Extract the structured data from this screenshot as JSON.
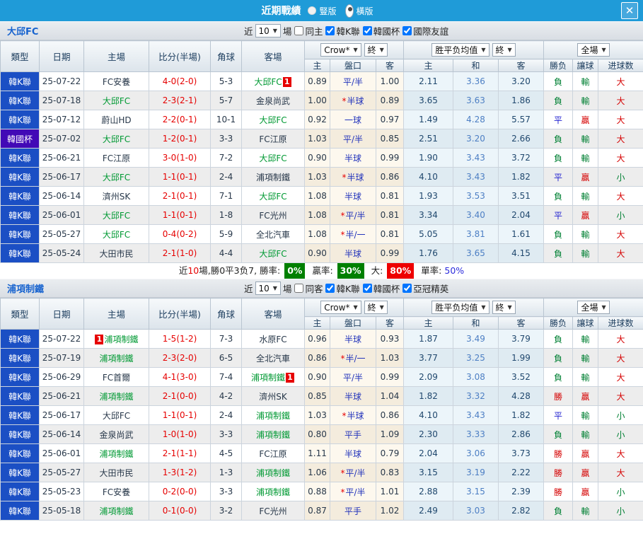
{
  "titlebar": {
    "title": "近期戰績",
    "radio_vertical": "豎版",
    "radio_horizontal": "橫版",
    "selected_mode": "橫版",
    "close_label": "✕"
  },
  "colors": {
    "titlebar_bg": "#1f9bd8",
    "league_badge": "#1b4fc4",
    "cup_badge": "#4209b6",
    "focus_team_green": "#009933",
    "score_red": "#e60000",
    "win_red": "#d50000",
    "draw_blue": "#2222d0",
    "lose_green": "#008033"
  },
  "table_header": {
    "type": "類型",
    "date": "日期",
    "home": "主場",
    "score": "比分(半場)",
    "corner": "角球",
    "away": "客場",
    "odds_select": "Crow*",
    "final_select": "終",
    "avg_select": "胜平负均值",
    "scope_select": "全場",
    "odds_home": "主",
    "odds_hcap": "盤口",
    "odds_away": "客",
    "avg_home": "主",
    "avg_draw": "和",
    "avg_away": "客",
    "res_wl": "勝负",
    "res_hcap": "讓球",
    "res_goals": "进球数"
  },
  "sections": [
    {
      "team": "大邱FC",
      "filter": {
        "near_label": "近",
        "games_value": "10",
        "games_label": "場",
        "same_label": "同主",
        "same_checked": false,
        "leagues": [
          {
            "label": "韓K聯",
            "checked": true
          },
          {
            "label": "韓國杯",
            "checked": true
          },
          {
            "label": "國際友誼",
            "checked": true
          }
        ]
      },
      "rows": [
        {
          "type": "韓K聯",
          "date": "25-07-22",
          "home": "FC安養",
          "home_focus": false,
          "home_badge": "",
          "score": "4-0(2-0)",
          "corner": "5-3",
          "away": "大邱FC",
          "away_focus": true,
          "away_badge": "1",
          "odds": [
            "0.89",
            "平/半",
            "1.00"
          ],
          "avg": [
            "2.11",
            "3.36",
            "3.20"
          ],
          "result": [
            "負",
            "輸",
            "大"
          ]
        },
        {
          "type": "韓K聯",
          "date": "25-07-18",
          "home": "大邱FC",
          "home_focus": true,
          "home_badge": "",
          "score": "2-3(2-1)",
          "corner": "5-7",
          "away": "金泉尚武",
          "away_focus": false,
          "away_badge": "",
          "odds": [
            "1.00",
            "*半球",
            "0.89"
          ],
          "avg": [
            "3.65",
            "3.63",
            "1.86"
          ],
          "result": [
            "負",
            "輸",
            "大"
          ]
        },
        {
          "type": "韓K聯",
          "date": "25-07-12",
          "home": "蔚山HD",
          "home_focus": false,
          "home_badge": "",
          "score": "2-2(0-1)",
          "corner": "10-1",
          "away": "大邱FC",
          "away_focus": true,
          "away_badge": "",
          "odds": [
            "0.92",
            "一球",
            "0.97"
          ],
          "avg": [
            "1.49",
            "4.28",
            "5.57"
          ],
          "result": [
            "平",
            "贏",
            "大"
          ]
        },
        {
          "type": "韓國杯",
          "date": "25-07-02",
          "home": "大邱FC",
          "home_focus": true,
          "home_badge": "",
          "score": "1-2(0-1)",
          "corner": "3-3",
          "away": "FC江原",
          "away_focus": false,
          "away_badge": "",
          "odds": [
            "1.03",
            "平/半",
            "0.85"
          ],
          "avg": [
            "2.51",
            "3.20",
            "2.66"
          ],
          "result": [
            "負",
            "輸",
            "大"
          ]
        },
        {
          "type": "韓K聯",
          "date": "25-06-21",
          "home": "FC江原",
          "home_focus": false,
          "home_badge": "",
          "score": "3-0(1-0)",
          "corner": "7-2",
          "away": "大邱FC",
          "away_focus": true,
          "away_badge": "",
          "odds": [
            "0.90",
            "半球",
            "0.99"
          ],
          "avg": [
            "1.90",
            "3.43",
            "3.72"
          ],
          "result": [
            "負",
            "輸",
            "大"
          ]
        },
        {
          "type": "韓K聯",
          "date": "25-06-17",
          "home": "大邱FC",
          "home_focus": true,
          "home_badge": "",
          "score": "1-1(0-1)",
          "corner": "2-4",
          "away": "浦項制鐵",
          "away_focus": false,
          "away_badge": "",
          "odds": [
            "1.03",
            "*半球",
            "0.86"
          ],
          "avg": [
            "4.10",
            "3.43",
            "1.82"
          ],
          "result": [
            "平",
            "贏",
            "小"
          ]
        },
        {
          "type": "韓K聯",
          "date": "25-06-14",
          "home": "濟州SK",
          "home_focus": false,
          "home_badge": "",
          "score": "2-1(0-1)",
          "corner": "7-1",
          "away": "大邱FC",
          "away_focus": true,
          "away_badge": "",
          "odds": [
            "1.08",
            "半球",
            "0.81"
          ],
          "avg": [
            "1.93",
            "3.53",
            "3.51"
          ],
          "result": [
            "負",
            "輸",
            "大"
          ]
        },
        {
          "type": "韓K聯",
          "date": "25-06-01",
          "home": "大邱FC",
          "home_focus": true,
          "home_badge": "",
          "score": "1-1(0-1)",
          "corner": "1-8",
          "away": "FC光州",
          "away_focus": false,
          "away_badge": "",
          "odds": [
            "1.08",
            "*平/半",
            "0.81"
          ],
          "avg": [
            "3.34",
            "3.40",
            "2.04"
          ],
          "result": [
            "平",
            "贏",
            "小"
          ]
        },
        {
          "type": "韓K聯",
          "date": "25-05-27",
          "home": "大邱FC",
          "home_focus": true,
          "home_badge": "",
          "score": "0-4(0-2)",
          "corner": "5-9",
          "away": "全北汽車",
          "away_focus": false,
          "away_badge": "",
          "odds": [
            "1.08",
            "*半/一",
            "0.81"
          ],
          "avg": [
            "5.05",
            "3.81",
            "1.61"
          ],
          "result": [
            "負",
            "輸",
            "大"
          ]
        },
        {
          "type": "韓K聯",
          "date": "25-05-24",
          "home": "大田市民",
          "home_focus": false,
          "home_badge": "",
          "score": "2-1(1-0)",
          "corner": "4-4",
          "away": "大邱FC",
          "away_focus": true,
          "away_badge": "",
          "odds": [
            "0.90",
            "半球",
            "0.99"
          ],
          "avg": [
            "1.76",
            "3.65",
            "4.15"
          ],
          "result": [
            "負",
            "輸",
            "大"
          ]
        }
      ],
      "summary": {
        "prefix": "近",
        "count": "10",
        "text": "場,勝0平3负7, 勝率:",
        "win_rate": "0%",
        "handicap_label": "贏率:",
        "handicap_rate": "30%",
        "big_label": "大:",
        "big_rate": "80%",
        "single_label": "單率:",
        "single_rate": "50%"
      }
    },
    {
      "team": "浦項制鐵",
      "filter": {
        "near_label": "近",
        "games_value": "10",
        "games_label": "場",
        "same_label": "同客",
        "same_checked": false,
        "leagues": [
          {
            "label": "韓K聯",
            "checked": true
          },
          {
            "label": "韓國杯",
            "checked": true
          },
          {
            "label": "亞冠精英",
            "checked": true
          }
        ]
      },
      "rows": [
        {
          "type": "韓K聯",
          "date": "25-07-22",
          "home": "浦項制鐵",
          "home_focus": true,
          "home_badge": "1",
          "score": "1-5(1-2)",
          "corner": "7-3",
          "away": "水原FC",
          "away_focus": false,
          "away_badge": "",
          "odds": [
            "0.96",
            "半球",
            "0.93"
          ],
          "avg": [
            "1.87",
            "3.49",
            "3.79"
          ],
          "result": [
            "負",
            "輸",
            "大"
          ]
        },
        {
          "type": "韓K聯",
          "date": "25-07-19",
          "home": "浦項制鐵",
          "home_focus": true,
          "home_badge": "",
          "score": "2-3(2-0)",
          "corner": "6-5",
          "away": "全北汽車",
          "away_focus": false,
          "away_badge": "",
          "odds": [
            "0.86",
            "*半/一",
            "1.03"
          ],
          "avg": [
            "3.77",
            "3.25",
            "1.99"
          ],
          "result": [
            "負",
            "輸",
            "大"
          ]
        },
        {
          "type": "韓K聯",
          "date": "25-06-29",
          "home": "FC首爾",
          "home_focus": false,
          "home_badge": "",
          "score": "4-1(3-0)",
          "corner": "7-4",
          "away": "浦項制鐵",
          "away_focus": true,
          "away_badge": "1",
          "odds": [
            "0.90",
            "平/半",
            "0.99"
          ],
          "avg": [
            "2.09",
            "3.08",
            "3.52"
          ],
          "result": [
            "負",
            "輸",
            "大"
          ]
        },
        {
          "type": "韓K聯",
          "date": "25-06-21",
          "home": "浦項制鐵",
          "home_focus": true,
          "home_badge": "",
          "score": "2-1(0-0)",
          "corner": "4-2",
          "away": "濟州SK",
          "away_focus": false,
          "away_badge": "",
          "odds": [
            "0.85",
            "半球",
            "1.04"
          ],
          "avg": [
            "1.82",
            "3.32",
            "4.28"
          ],
          "result": [
            "勝",
            "贏",
            "大"
          ]
        },
        {
          "type": "韓K聯",
          "date": "25-06-17",
          "home": "大邱FC",
          "home_focus": false,
          "home_badge": "",
          "score": "1-1(0-1)",
          "corner": "2-4",
          "away": "浦項制鐵",
          "away_focus": true,
          "away_badge": "",
          "odds": [
            "1.03",
            "*半球",
            "0.86"
          ],
          "avg": [
            "4.10",
            "3.43",
            "1.82"
          ],
          "result": [
            "平",
            "輸",
            "小"
          ]
        },
        {
          "type": "韓K聯",
          "date": "25-06-14",
          "home": "金泉尚武",
          "home_focus": false,
          "home_badge": "",
          "score": "1-0(1-0)",
          "corner": "3-3",
          "away": "浦項制鐵",
          "away_focus": true,
          "away_badge": "",
          "odds": [
            "0.80",
            "平手",
            "1.09"
          ],
          "avg": [
            "2.30",
            "3.33",
            "2.86"
          ],
          "result": [
            "負",
            "輸",
            "小"
          ]
        },
        {
          "type": "韓K聯",
          "date": "25-06-01",
          "home": "浦項制鐵",
          "home_focus": true,
          "home_badge": "",
          "score": "2-1(1-1)",
          "corner": "4-5",
          "away": "FC江原",
          "away_focus": false,
          "away_badge": "",
          "odds": [
            "1.11",
            "半球",
            "0.79"
          ],
          "avg": [
            "2.04",
            "3.06",
            "3.73"
          ],
          "result": [
            "勝",
            "贏",
            "大"
          ]
        },
        {
          "type": "韓K聯",
          "date": "25-05-27",
          "home": "大田市民",
          "home_focus": false,
          "home_badge": "",
          "score": "1-3(1-2)",
          "corner": "1-3",
          "away": "浦項制鐵",
          "away_focus": true,
          "away_badge": "",
          "odds": [
            "1.06",
            "*平/半",
            "0.83"
          ],
          "avg": [
            "3.15",
            "3.19",
            "2.22"
          ],
          "result": [
            "勝",
            "贏",
            "大"
          ]
        },
        {
          "type": "韓K聯",
          "date": "25-05-23",
          "home": "FC安養",
          "home_focus": false,
          "home_badge": "",
          "score": "0-2(0-0)",
          "corner": "3-3",
          "away": "浦項制鐵",
          "away_focus": true,
          "away_badge": "",
          "odds": [
            "0.88",
            "*平/半",
            "1.01"
          ],
          "avg": [
            "2.88",
            "3.15",
            "2.39"
          ],
          "result": [
            "勝",
            "贏",
            "小"
          ]
        },
        {
          "type": "韓K聯",
          "date": "25-05-18",
          "home": "浦項制鐵",
          "home_focus": true,
          "home_badge": "",
          "score": "0-1(0-0)",
          "corner": "3-2",
          "away": "FC光州",
          "away_focus": false,
          "away_badge": "",
          "odds": [
            "0.87",
            "平手",
            "1.02"
          ],
          "avg": [
            "2.49",
            "3.03",
            "2.82"
          ],
          "result": [
            "負",
            "輸",
            "小"
          ]
        }
      ]
    }
  ]
}
